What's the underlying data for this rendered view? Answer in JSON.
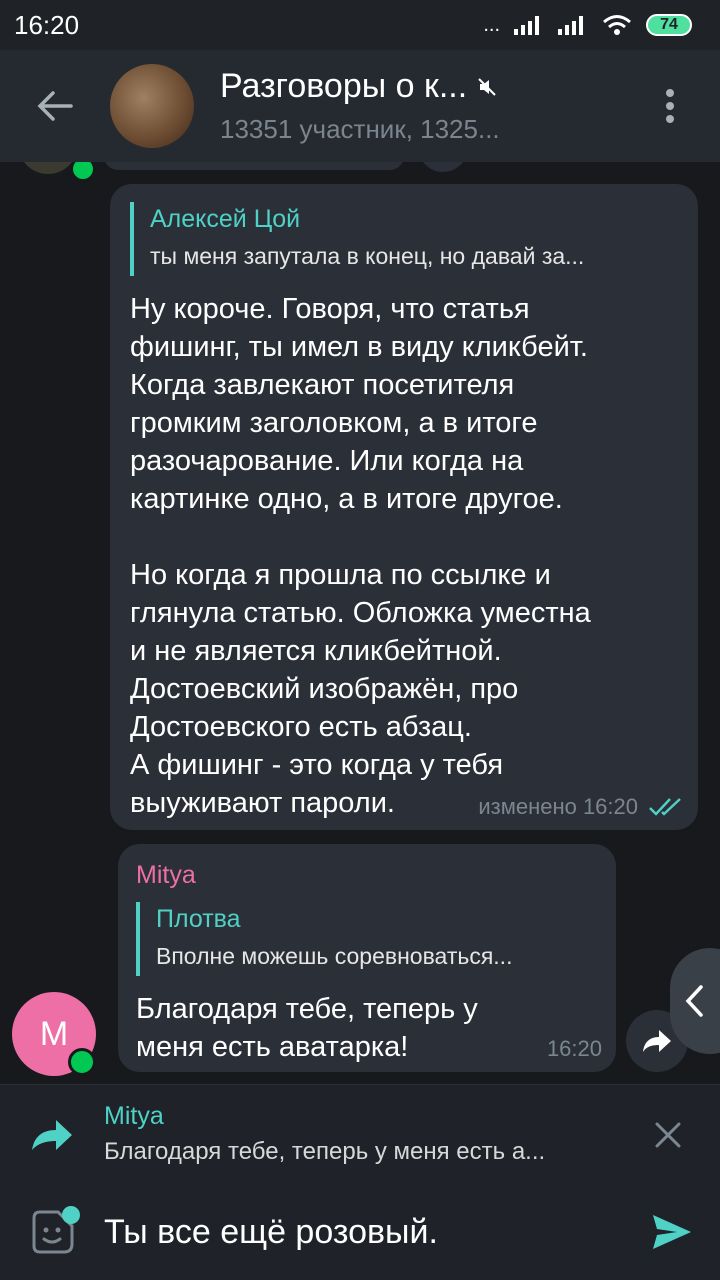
{
  "status_bar": {
    "time": "16:20",
    "signal_dots": "...",
    "battery": "74"
  },
  "header": {
    "title": "Разговоры о к...",
    "subtitle": "13351 участник, 1325..."
  },
  "messages": [
    {
      "reply": {
        "author": "Алексей Цой",
        "text": "ты меня запутала в конец, но давай за..."
      },
      "text": "Ну короче. Говоря, что статья\nфишинг, ты имел в виду кликбейт.\nКогда завлекают посетителя\nгромким заголовком, а в итоге\nразочарование. Или когда на\nкартинке одно, а в итоге другое.\n\nНо когда я прошла по ссылке и\nглянула статью. Обложка уместна\nи не является кликбейтной.\nДостоевский изображён, про\nДостоевского есть абзац.\nА фишинг - это когда у тебя\nвыуживают пароли.",
      "meta": "изменено 16:20"
    },
    {
      "sender": "Mitya",
      "avatar_letter": "M",
      "reply": {
        "author": "Плотва",
        "text": "Вполне можешь соревноваться..."
      },
      "text": "Благодаря тебе, теперь у\nменя есть аватарка!",
      "meta": "16:20"
    }
  ],
  "reply_panel": {
    "name": "Mitya",
    "text": "Благодаря тебе, теперь у меня есть а..."
  },
  "composer": {
    "value": "Ты все ещё розовый."
  },
  "colors": {
    "accent": "#4fd1c5",
    "sender_pink": "#ee6fa6",
    "bubble": "#2b3038",
    "background": "#17191d",
    "online": "#00c853"
  }
}
